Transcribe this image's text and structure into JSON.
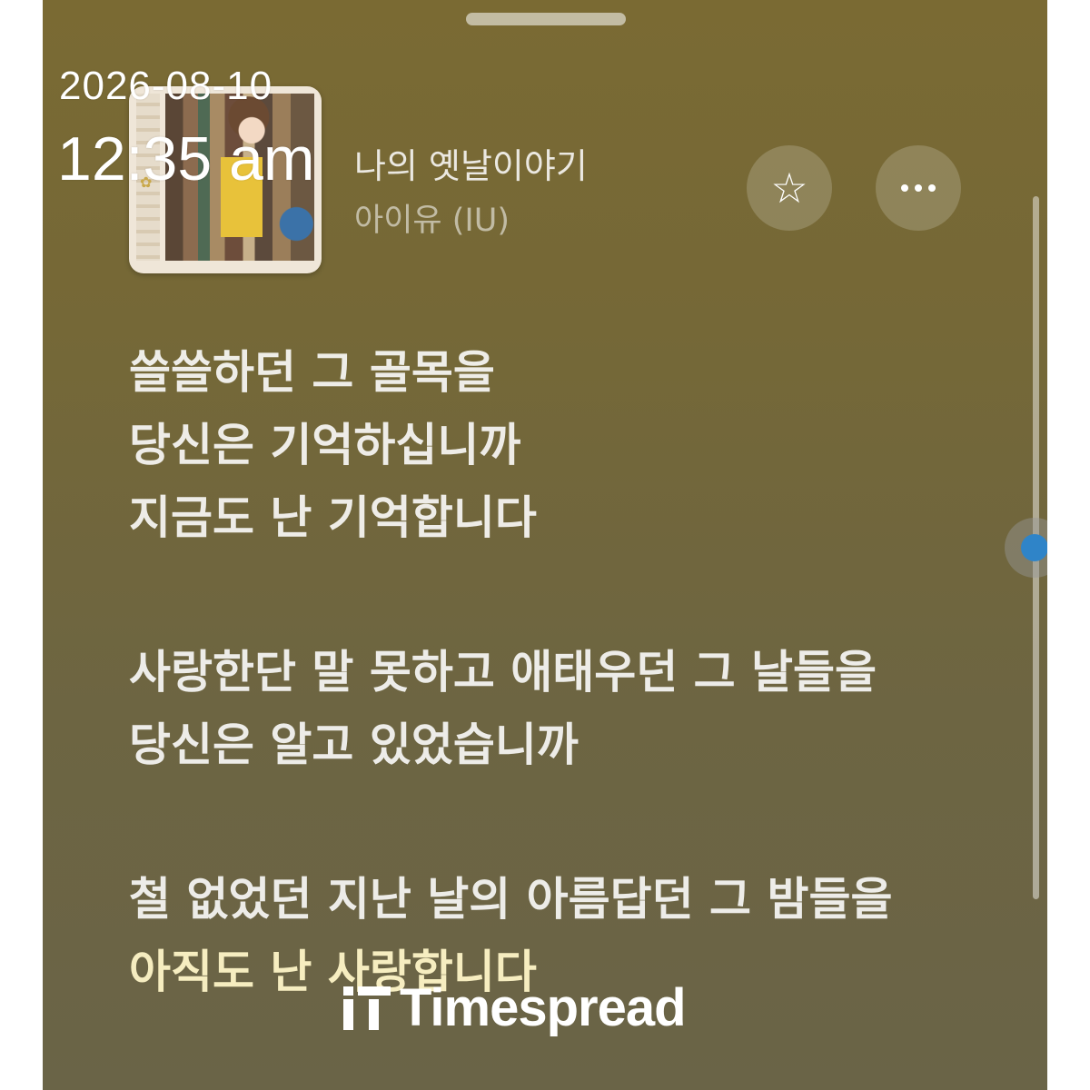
{
  "status": {
    "date": "2026-08-10",
    "time": "12:35 am"
  },
  "player": {
    "song_title": "나의 옛날이야기",
    "artist": "아이유 (IU)",
    "favorite_icon": "star-outline-icon",
    "more_icon": "more-horizontal-icon"
  },
  "lyrics": {
    "lines": [
      "쓸쓸하던 그 골목을",
      "당신은 기억하십니까",
      "지금도 난 기억합니다",
      "사랑한단 말 못하고 애태우던 그 날들을",
      "당신은 알고 있었습니까",
      "철 없었던 지난 날의 아름답던 그 밤들을",
      "아직도 난 사랑합니다"
    ]
  },
  "scroll": {
    "position": 0.46
  },
  "watermark": {
    "text": "Timespread"
  },
  "colors": {
    "background_top": "#7a6a33",
    "background_bottom": "#6a6447",
    "scroll_dot": "#2f84c8"
  }
}
